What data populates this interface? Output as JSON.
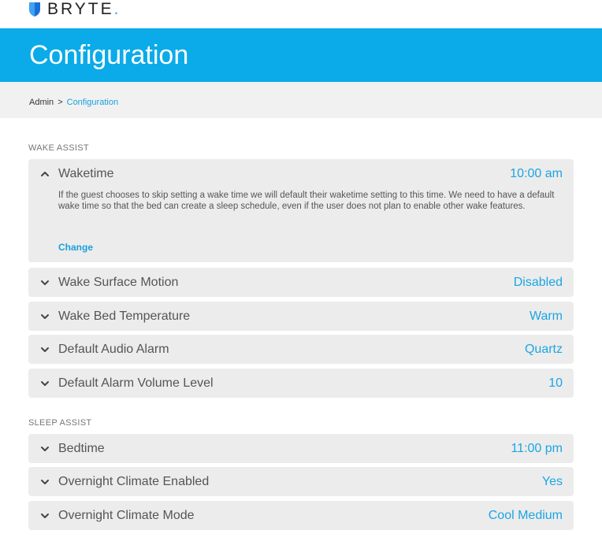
{
  "brand": {
    "name": "BRYTE",
    "dot": ".",
    "accent": "#0aabe8"
  },
  "header": {
    "title": "Configuration"
  },
  "breadcrumb": {
    "root": "Admin",
    "separator": ">",
    "current": "Configuration"
  },
  "sections": {
    "wake": {
      "title": "WAKE ASSIST",
      "waketime": {
        "label": "Waketime",
        "value": "10:00 am",
        "expanded": true,
        "description": "If the guest chooses to skip setting a wake time we will default their waketime setting to this time. We need to have a default wake time so that the bed can create a sleep schedule, even if the user does not plan to enable other wake features.",
        "change_label": "Change"
      },
      "surface_motion": {
        "label": "Wake Surface Motion",
        "value": "Disabled"
      },
      "bed_temperature": {
        "label": "Wake Bed Temperature",
        "value": "Warm"
      },
      "audio_alarm": {
        "label": "Default Audio Alarm",
        "value": "Quartz"
      },
      "alarm_volume": {
        "label": "Default Alarm Volume Level",
        "value": "10"
      }
    },
    "sleep": {
      "title": "SLEEP ASSIST",
      "bedtime": {
        "label": "Bedtime",
        "value": "11:00 pm"
      },
      "climate_enabled": {
        "label": "Overnight Climate Enabled",
        "value": "Yes"
      },
      "climate_mode": {
        "label": "Overnight Climate Mode",
        "value": "Cool Medium"
      }
    }
  }
}
